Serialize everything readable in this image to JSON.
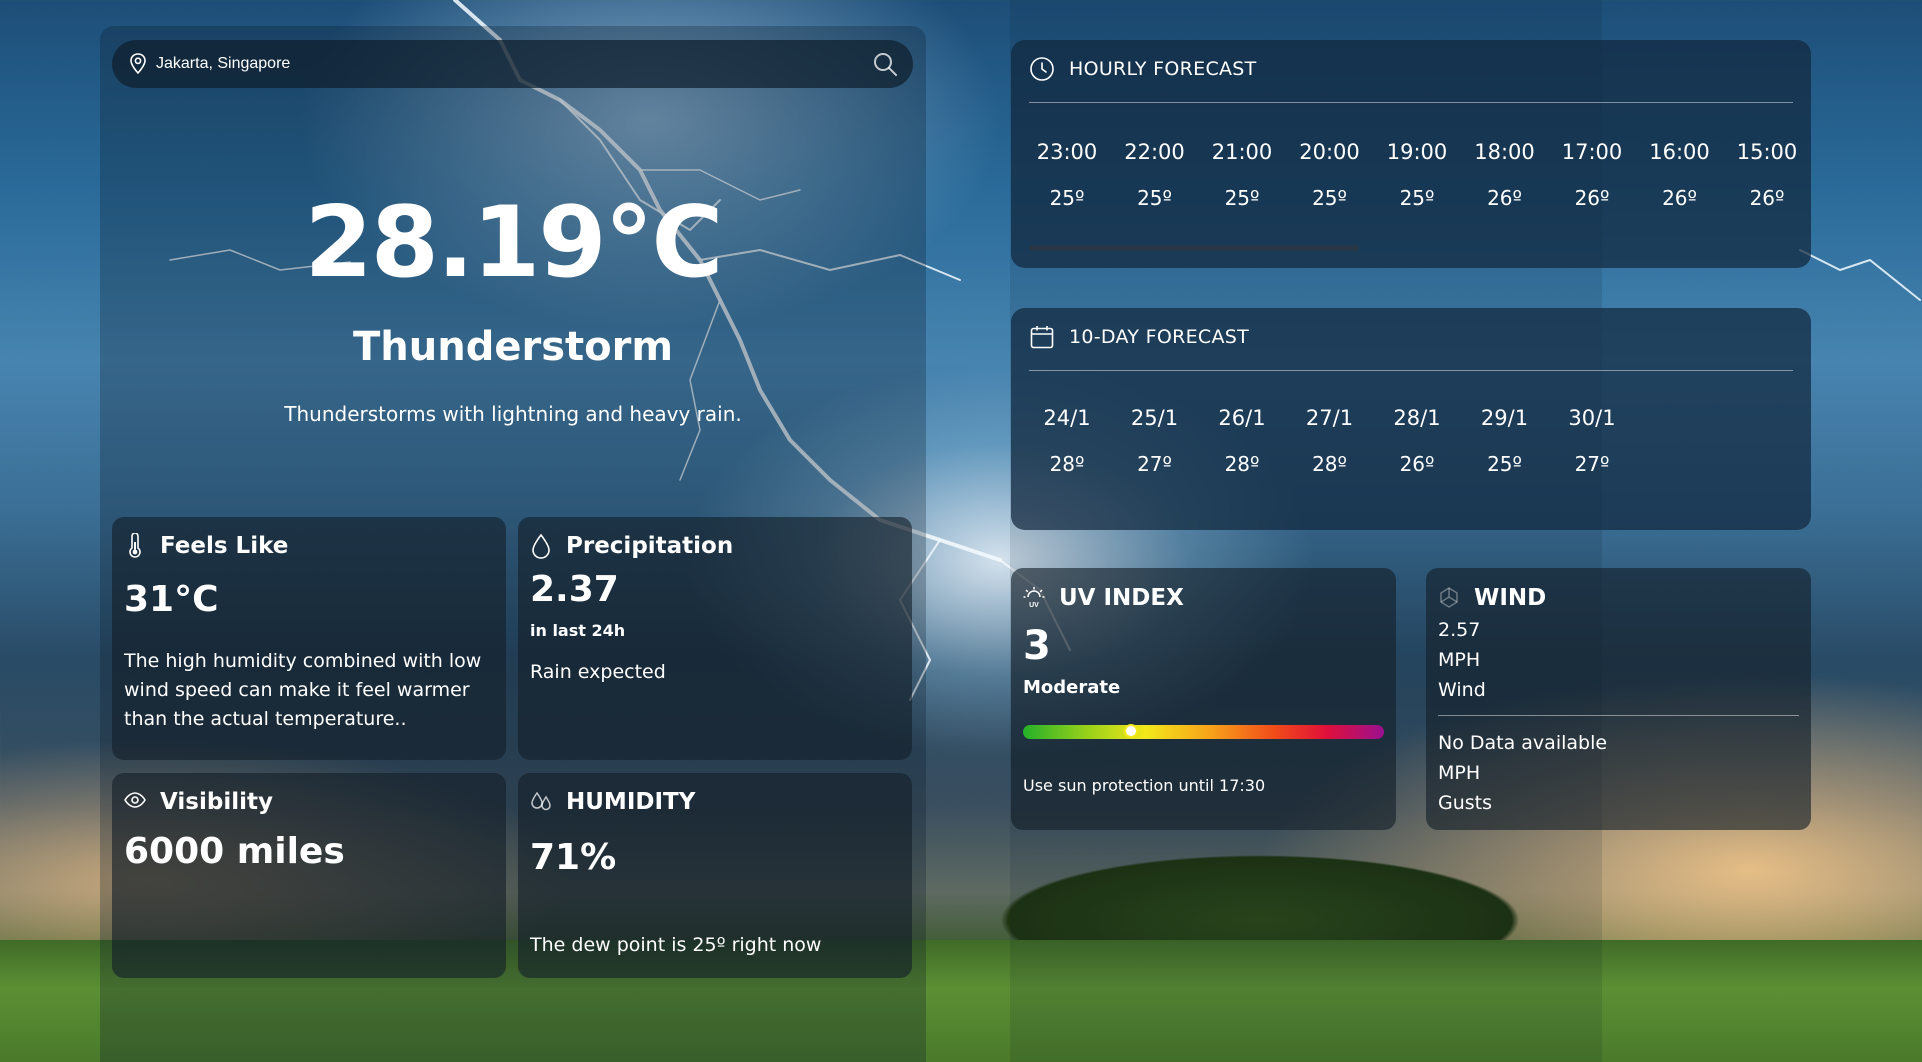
{
  "search": {
    "value": "Jakarta, Singapore",
    "placeholder": ""
  },
  "current": {
    "temperature": "28.19°C",
    "condition": "Thunderstorm",
    "description": "Thunderstorms with lightning and heavy rain."
  },
  "cards": {
    "feels_like": {
      "title": "Feels Like",
      "value": "31°C",
      "text": "The high humidity combined with low wind speed can make it feel warmer than the actual temperature.."
    },
    "precipitation": {
      "title": "Precipitation",
      "value": "2.37",
      "subtitle": "in last 24h",
      "text": "Rain expected"
    },
    "visibility": {
      "title": "Visibility",
      "value": "6000 miles"
    },
    "humidity": {
      "title": "HUMIDITY",
      "value": "71%",
      "text": "The dew point is 25º right now"
    }
  },
  "hourly": {
    "title": "HOURLY FORECAST",
    "items": [
      {
        "time": "23:00",
        "temp": "25º"
      },
      {
        "time": "22:00",
        "temp": "25º"
      },
      {
        "time": "21:00",
        "temp": "25º"
      },
      {
        "time": "20:00",
        "temp": "25º"
      },
      {
        "time": "19:00",
        "temp": "25º"
      },
      {
        "time": "18:00",
        "temp": "26º"
      },
      {
        "time": "17:00",
        "temp": "26º"
      },
      {
        "time": "16:00",
        "temp": "26º"
      },
      {
        "time": "15:00",
        "temp": "26º"
      }
    ]
  },
  "daily": {
    "title": "10-DAY FORECAST",
    "items": [
      {
        "date": "24/1",
        "temp": "28º"
      },
      {
        "date": "25/1",
        "temp": "27º"
      },
      {
        "date": "26/1",
        "temp": "28º"
      },
      {
        "date": "27/1",
        "temp": "28º"
      },
      {
        "date": "28/1",
        "temp": "26º"
      },
      {
        "date": "29/1",
        "temp": "25º"
      },
      {
        "date": "30/1",
        "temp": "27º"
      }
    ]
  },
  "uv": {
    "title": "UV INDEX",
    "value": "3",
    "level": "Moderate",
    "level_fraction": 0.3,
    "advice": "Use sun protection until 17:30"
  },
  "wind": {
    "title": "WIND",
    "speed_value": "2.57",
    "speed_unit": "MPH",
    "speed_label": "Wind",
    "gust_value": "No Data available",
    "gust_unit": "MPH",
    "gust_label": "Gusts"
  }
}
